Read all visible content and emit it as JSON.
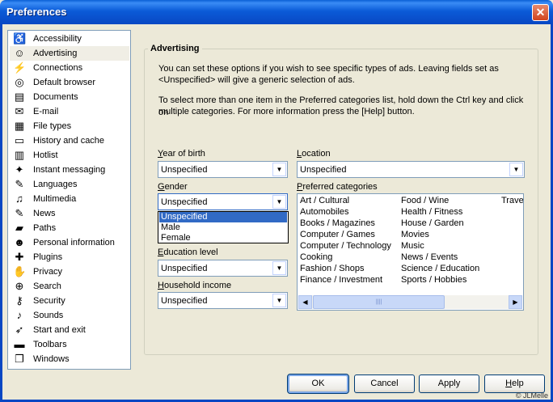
{
  "window": {
    "title": "Preferences",
    "close_symbol": "✕"
  },
  "sidebar": {
    "items": [
      {
        "label": "Accessibility",
        "icon": "accessibility-icon",
        "glyph": "♿"
      },
      {
        "label": "Advertising",
        "icon": "smiley-icon",
        "glyph": "☺"
      },
      {
        "label": "Connections",
        "icon": "plug-icon",
        "glyph": "⚡"
      },
      {
        "label": "Default browser",
        "icon": "browser-icon",
        "glyph": "◎"
      },
      {
        "label": "Documents",
        "icon": "documents-icon",
        "glyph": "▤"
      },
      {
        "label": "E-mail",
        "icon": "envelope-icon",
        "glyph": "✉"
      },
      {
        "label": "File types",
        "icon": "file-types-icon",
        "glyph": "▦"
      },
      {
        "label": "History and cache",
        "icon": "cache-icon",
        "glyph": "▭"
      },
      {
        "label": "Hotlist",
        "icon": "hotlist-icon",
        "glyph": "▥"
      },
      {
        "label": "Instant messaging",
        "icon": "messaging-icon",
        "glyph": "✦"
      },
      {
        "label": "Languages",
        "icon": "languages-icon",
        "glyph": "✎"
      },
      {
        "label": "Multimedia",
        "icon": "multimedia-icon",
        "glyph": "♫"
      },
      {
        "label": "News",
        "icon": "news-icon",
        "glyph": "✎"
      },
      {
        "label": "Paths",
        "icon": "folder-icon",
        "glyph": "▰"
      },
      {
        "label": "Personal information",
        "icon": "person-icon",
        "glyph": "☻"
      },
      {
        "label": "Plugins",
        "icon": "plugins-icon",
        "glyph": "✚"
      },
      {
        "label": "Privacy",
        "icon": "privacy-icon",
        "glyph": "✋"
      },
      {
        "label": "Search",
        "icon": "search-icon",
        "glyph": "⊕"
      },
      {
        "label": "Security",
        "icon": "key-icon",
        "glyph": "⚷"
      },
      {
        "label": "Sounds",
        "icon": "speaker-icon",
        "glyph": "♪"
      },
      {
        "label": "Start and exit",
        "icon": "start-exit-icon",
        "glyph": "➶"
      },
      {
        "label": "Toolbars",
        "icon": "toolbars-icon",
        "glyph": "▬"
      },
      {
        "label": "Windows",
        "icon": "windows-icon",
        "glyph": "❐"
      }
    ],
    "selected_index": 1
  },
  "advertising": {
    "group_title": "Advertising",
    "intro_line1": "You can set these options if you wish to see specific types of ads. Leaving fields set as",
    "intro_line2": "<Unspecified> will give a generic selection of ads.",
    "help_line1": "To select more than one item in the Preferred categories list, hold down the Ctrl key and click on",
    "help_line2": "multiple categories. For more information press the [Help] button.",
    "year_of_birth": {
      "label_u": "Y",
      "label_rest": "ear of birth",
      "value": "Unspecified"
    },
    "gender": {
      "label_u": "G",
      "label_rest": "ender",
      "value": "Unspecified",
      "options": [
        "Unspecified",
        "Male",
        "Female"
      ],
      "highlighted": "Unspecified"
    },
    "education": {
      "label_u": "E",
      "label_rest": "ducation level",
      "value": "Unspecified"
    },
    "income": {
      "label_u": "H",
      "label_rest": "ousehold income",
      "value": "Unspecified"
    },
    "location": {
      "label_u": "L",
      "label_rest": "ocation",
      "value": "Unspecified"
    },
    "categories": {
      "label_u": "P",
      "label_rest": "referred categories",
      "col1": [
        "Art / Cultural",
        "Automobiles",
        "Books / Magazines",
        "Computer / Games",
        "Computer / Technology",
        "Cooking",
        "Fashion / Shops",
        "Finance / Investment"
      ],
      "col2": [
        "Food / Wine",
        "Health / Fitness",
        "House / Garden",
        "Movies",
        "Music",
        "News / Events",
        "Science / Education",
        "Sports / Hobbies"
      ],
      "col3": [
        "Trave"
      ]
    }
  },
  "buttons": {
    "ok": "OK",
    "cancel": "Cancel",
    "apply": "Apply",
    "help_u": "H",
    "help_rest": "elp"
  },
  "copyright": "© JLMelle",
  "glyphs": {
    "dropdown_arrow": "▼",
    "scroll_left": "◀",
    "scroll_right": "▶",
    "grip": "||||"
  },
  "colors": {
    "title_bar": "#0b5bd8",
    "selection": "#316ac5",
    "close": "#d2441e"
  }
}
